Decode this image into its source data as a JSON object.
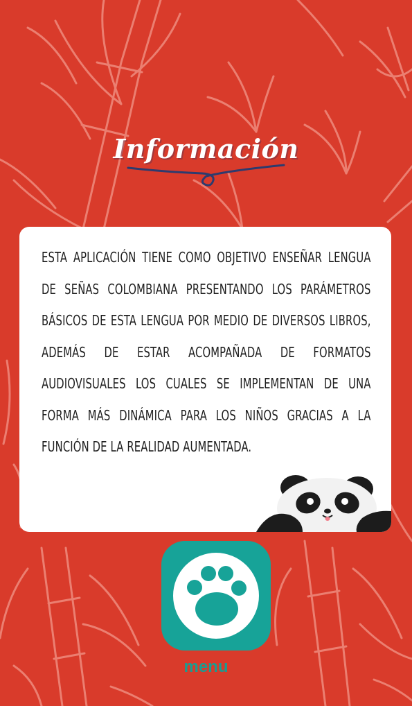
{
  "page": {
    "title": "Información",
    "description": "Esta aplicación tiene como objetivo enseñar lengua de señas colombiana presentando los parámetros básicos de esta lengua por medio de diversos libros, además de estar acompañada de formatos audiovisuales los cuales se implementan de una forma más dinámica para los niños gracias a la función de la realidad aumentada.",
    "menu_label": "menu"
  },
  "colors": {
    "background": "#d93b2b",
    "card": "#ffffff",
    "accent": "#17a398",
    "title_underline": "#2d3b6e"
  },
  "icons": {
    "decoration": "bamboo-pattern",
    "mascot": "panda-peeking-icon",
    "menu": "paw-print-icon"
  }
}
